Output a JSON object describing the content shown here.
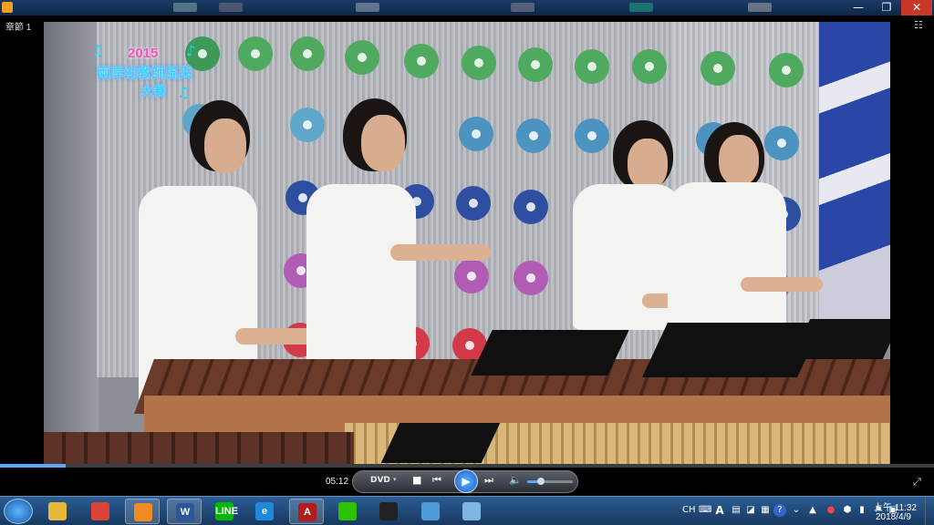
{
  "window": {
    "minimize_icon": "minimize-icon",
    "maximize_icon": "restore-icon",
    "close_icon": "close-icon",
    "minimize_glyph": "—",
    "restore_glyph": "❐",
    "close_glyph": "✕"
  },
  "chapter_label": "章節 1",
  "video": {
    "logo_year": "2015",
    "logo_main": "兩岸幼教師風采",
    "logo_sub": "大賽",
    "progress": 0.07
  },
  "controls": {
    "time": "05:12",
    "disc_label": "DVD",
    "disc_arrow": "▾",
    "stop_glyph": "■",
    "prev_glyph": "⏮",
    "play_glyph": "▶",
    "next_glyph": "⏭",
    "volume_glyph": "🔈",
    "fullscreen_glyph": "⤢",
    "volume_level": 0.3
  },
  "taskbar": {
    "apps": [
      {
        "name": "explorer",
        "label": "",
        "color": "#e5b93a",
        "active": false
      },
      {
        "name": "chrome",
        "label": "",
        "color": "#db4437",
        "active": false
      },
      {
        "name": "media-player",
        "label": "",
        "color": "#f08a24",
        "active": true
      },
      {
        "name": "word",
        "label": "W",
        "color": "#2b5797",
        "active": true
      },
      {
        "name": "line",
        "label": "LINE",
        "color": "#00b900",
        "active": false
      },
      {
        "name": "ie",
        "label": "e",
        "color": "#1e88d9",
        "active": false
      },
      {
        "name": "acrobat",
        "label": "A",
        "color": "#b11d1d",
        "active": true
      },
      {
        "name": "wechat",
        "label": "",
        "color": "#2dc100",
        "active": false
      },
      {
        "name": "qq",
        "label": "",
        "color": "#222",
        "active": false
      },
      {
        "name": "photo-viewer",
        "label": "",
        "color": "#4f9ad8",
        "active": false
      },
      {
        "name": "paint",
        "label": "",
        "color": "#7fb5e0",
        "active": false
      }
    ],
    "tray": {
      "lang": "CH",
      "ime": "A",
      "help": "?",
      "clock_time": "上午 11:32",
      "clock_date": "2018/4/9"
    }
  }
}
